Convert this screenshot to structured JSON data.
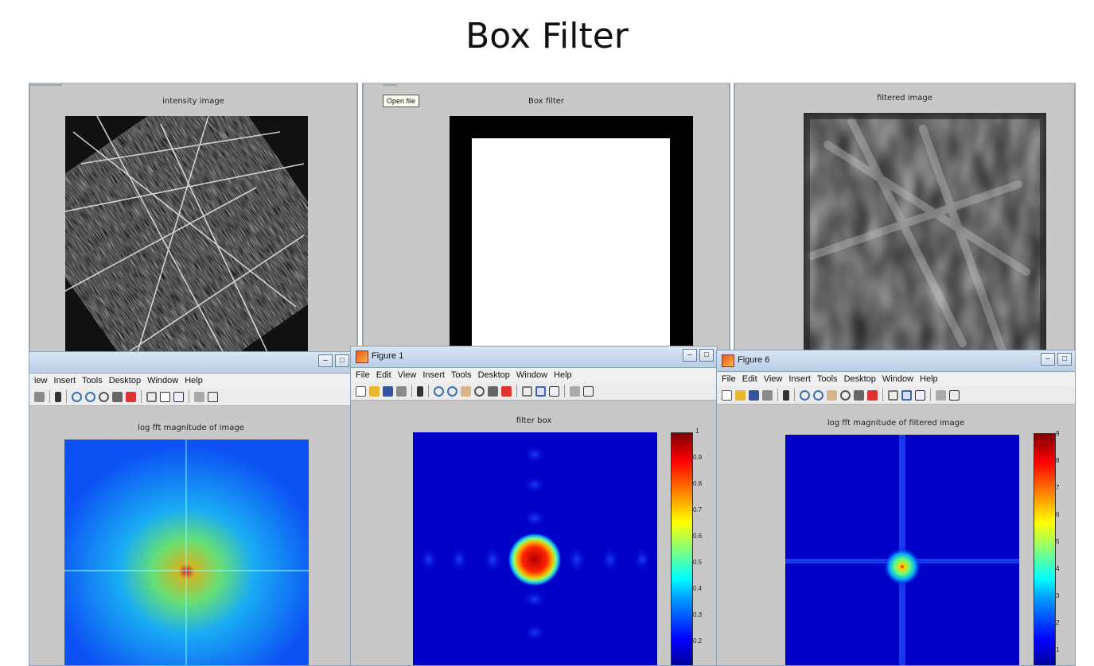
{
  "page_title": "Box Filter",
  "top_row": [
    {
      "title": "intensity image"
    },
    {
      "title": "Box filter",
      "open_file_button": "Open file"
    },
    {
      "title": "filtered image"
    }
  ],
  "figures": [
    {
      "window_title": "",
      "menu": [
        "iew",
        "Insert",
        "Tools",
        "Desktop",
        "Window",
        "Help"
      ],
      "plot_title": "log fft magnitude of image"
    },
    {
      "window_title": "Figure 1",
      "menu": [
        "File",
        "Edit",
        "View",
        "Insert",
        "Tools",
        "Desktop",
        "Window",
        "Help"
      ],
      "plot_title": "filter box",
      "colorbar_ticks": [
        "1",
        "0.9",
        "0.8",
        "0.7",
        "0.6",
        "0.5",
        "0.4",
        "0.3",
        "0.2"
      ]
    },
    {
      "window_title": "Figure 6",
      "menu": [
        "File",
        "Edit",
        "View",
        "Insert",
        "Tools",
        "Desktop",
        "Window",
        "Help"
      ],
      "plot_title": "log fft magnitude of filtered image",
      "colorbar_ticks": [
        "9",
        "8",
        "7",
        "6",
        "5",
        "4",
        "3",
        "2",
        "1"
      ]
    }
  ],
  "colors": {
    "matlab_bg": "#c8c8c8",
    "jet_low": "#00008f",
    "jet_high": "#800000"
  },
  "icons": [
    "new-file-icon",
    "open-folder-icon",
    "save-icon",
    "print-icon",
    "pointer-icon",
    "zoom-in-icon",
    "zoom-out-icon",
    "pan-icon",
    "rotate-icon",
    "data-cursor-icon",
    "brush-icon",
    "link-icon",
    "colorbar-icon",
    "legend-icon",
    "hide-plot-icon",
    "show-plot-icon"
  ]
}
